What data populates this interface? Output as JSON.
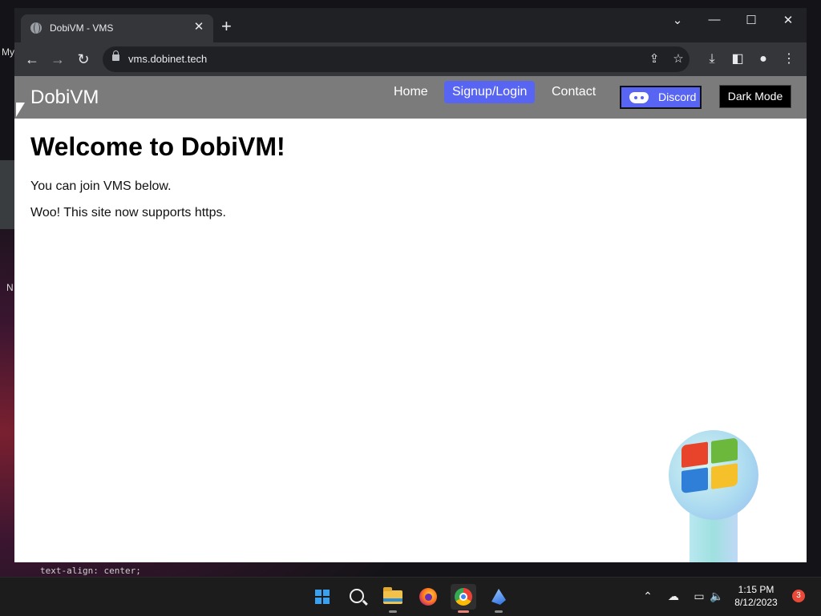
{
  "desktop": {
    "label_top": "My",
    "label_mid": "N"
  },
  "browser": {
    "tab_title": "DobiVM - VMS",
    "url": "vms.dobinet.tech",
    "tab_close_glyph": "✕",
    "newtab_glyph": "+",
    "icons": [
      "back-icon",
      "forward-icon",
      "reload-icon",
      "lock-icon",
      "share-icon",
      "star-icon",
      "download-icon",
      "side-panel-icon",
      "profile-icon",
      "menu-icon"
    ]
  },
  "site": {
    "brand": "DobiVM",
    "nav": [
      {
        "label": "Home"
      },
      {
        "label": "Signup/Login"
      },
      {
        "label": "Contact"
      }
    ],
    "discord_label": "Discord",
    "darkmode_label": "Dark Mode",
    "heading": "Welcome to DobiVM!",
    "paragraphs": [
      "You can join VMS below.",
      "Woo! This site now supports https."
    ],
    "accent": "#5865f2"
  },
  "behind_text": "text-align: center;",
  "taskbar": {
    "apps": [
      "start-icon",
      "search-icon",
      "file-explorer-icon",
      "firefox-icon",
      "chrome-icon",
      "bird-app-icon"
    ],
    "time": "1:15 PM",
    "date": "8/12/2023",
    "notification_count": "3"
  }
}
